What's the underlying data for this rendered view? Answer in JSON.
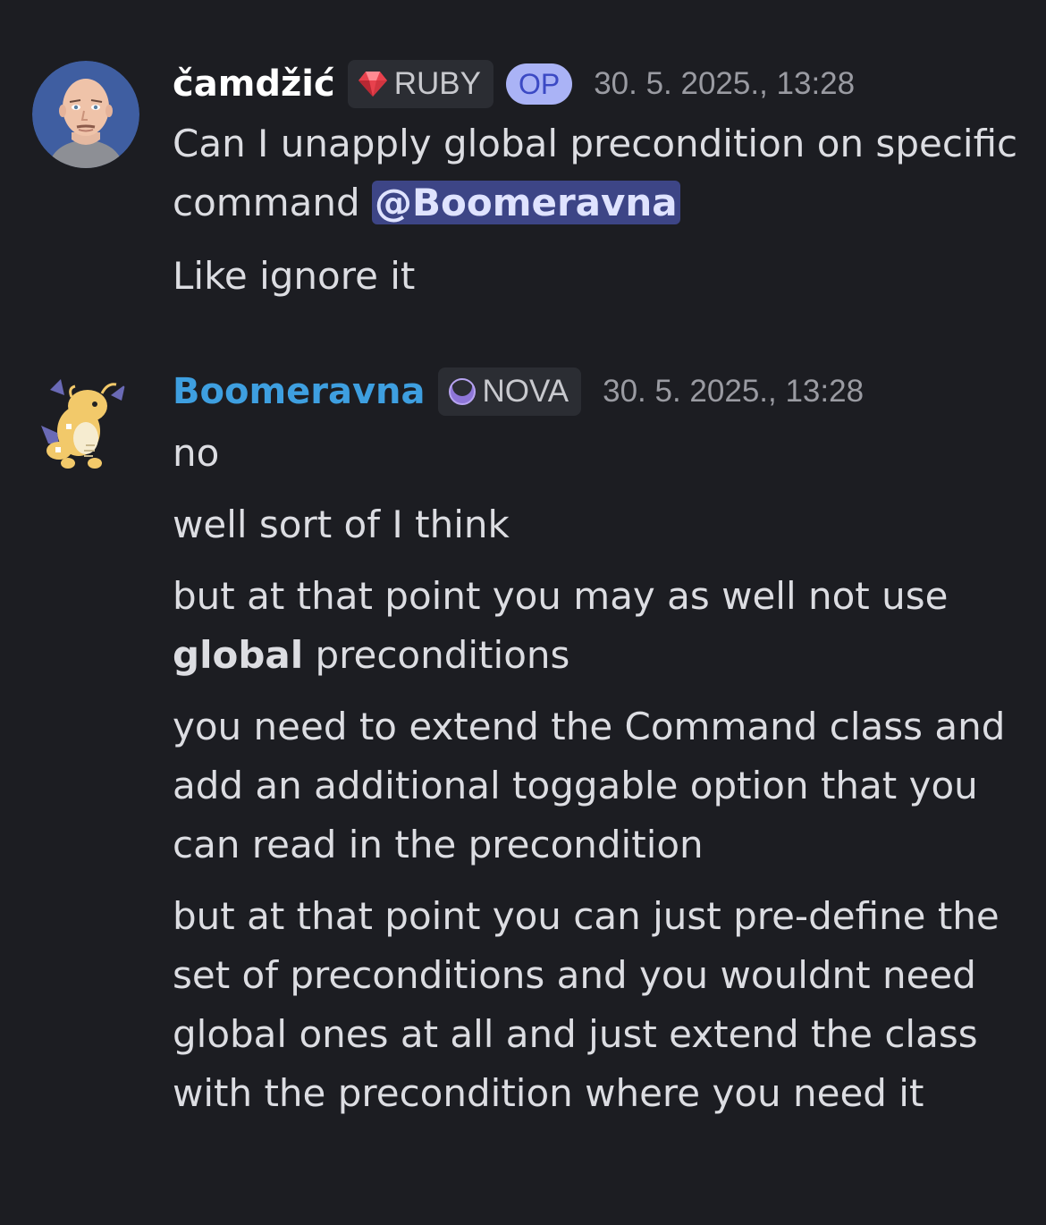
{
  "messages": [
    {
      "author": "čamdžić",
      "role": "RUBY",
      "op_badge": "OP",
      "timestamp": "30. 5. 2025., 13:28",
      "author_color": "#ffffff",
      "lines": [
        {
          "pre": "Can I unapply global precondition on specific command ",
          "mention": "@Boomeravna"
        },
        {
          "text": "Like ignore it"
        }
      ]
    },
    {
      "author": "Boomeravna",
      "role": "NOVA",
      "timestamp": "30. 5. 2025., 13:28",
      "author_color": "#3e9fe0",
      "lines": [
        {
          "text": "no"
        },
        {
          "text": "well sort of I think"
        },
        {
          "pre": "but at that point you may as well not use ",
          "bold": "global",
          "post": " preconditions"
        },
        {
          "text": "you need to extend the Command class and add an additional toggable option that you can read in the precondition"
        },
        {
          "text": "but at that point you can just pre-define the set of preconditions and you wouldnt need global ones at all and just extend the class with the precondition where you need it"
        }
      ]
    }
  ],
  "colors": {
    "background": "#1c1d22",
    "mention_bg": "#3d4586",
    "op_bg": "#aab3f6",
    "ruby_icon": "#e8414d",
    "nova_icon": "#8e76d8"
  },
  "icons": {
    "ruby": "ruby-gem-icon",
    "nova": "crescent-moon-icon"
  }
}
